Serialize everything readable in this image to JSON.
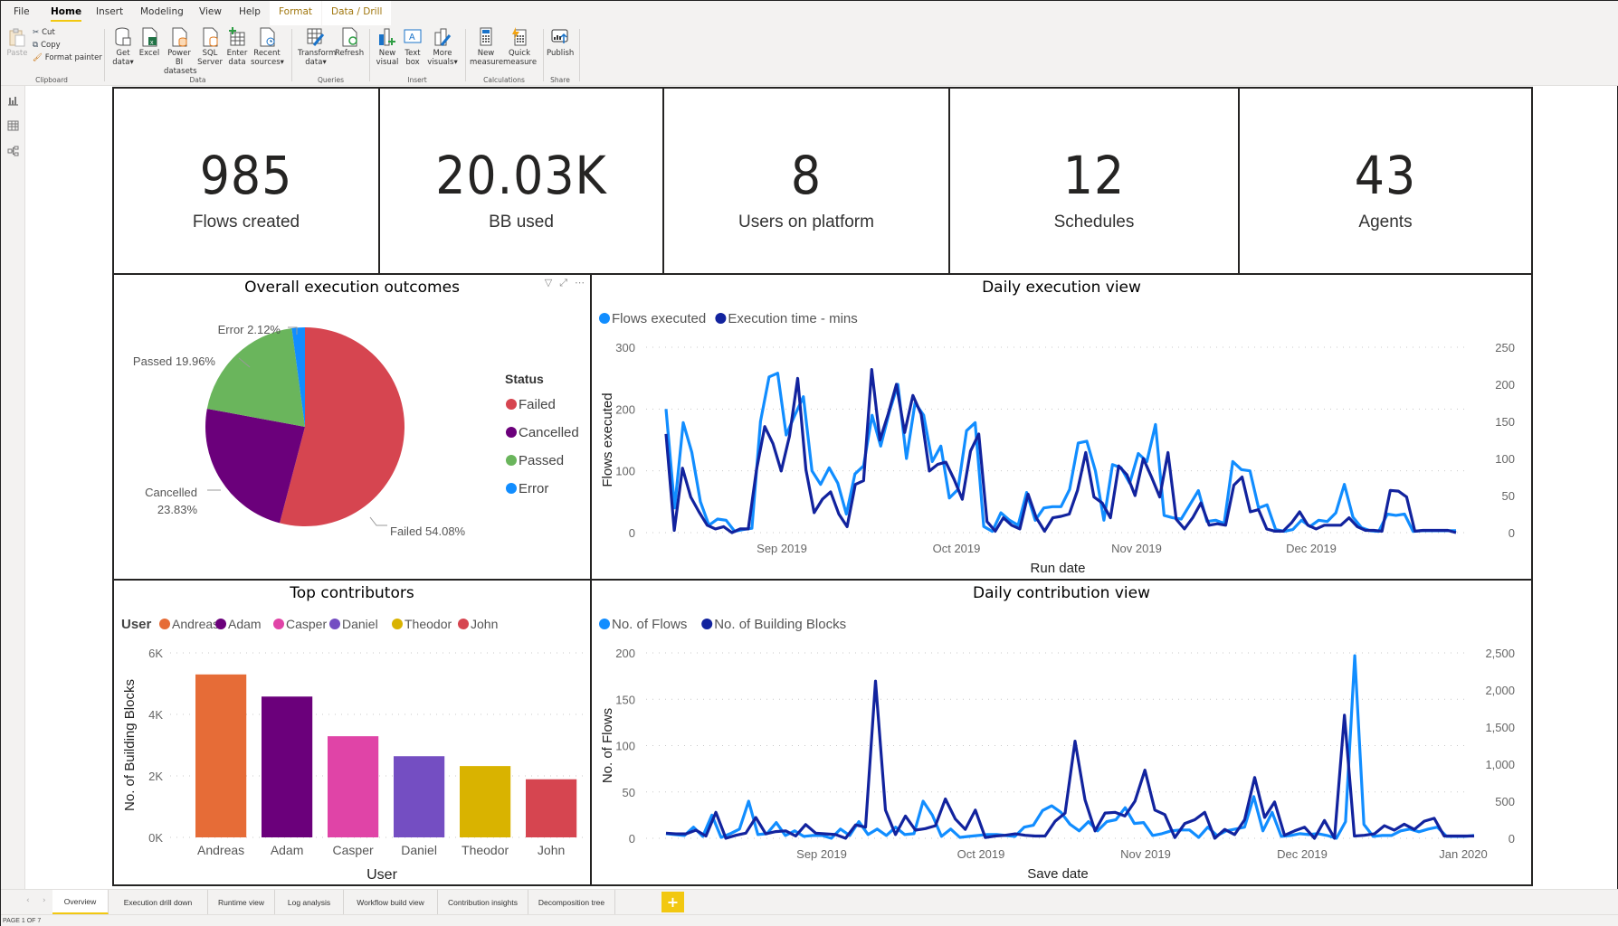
{
  "ribbon": {
    "tabs": [
      {
        "label": "File",
        "active": false,
        "contextual": false
      },
      {
        "label": "Home",
        "active": true,
        "contextual": false
      },
      {
        "label": "Insert",
        "active": false,
        "contextual": false
      },
      {
        "label": "Modeling",
        "active": false,
        "contextual": false
      },
      {
        "label": "View",
        "active": false,
        "contextual": false
      },
      {
        "label": "Help",
        "active": false,
        "contextual": false
      },
      {
        "label": "Format",
        "active": false,
        "contextual": true
      },
      {
        "label": "Data / Drill",
        "active": false,
        "contextual": true
      }
    ],
    "clipboard": {
      "paste": "Paste",
      "cut": "Cut",
      "copy": "Copy",
      "format_painter": "Format painter",
      "group": "Clipboard"
    },
    "data": {
      "get_data": [
        "Get",
        "data"
      ],
      "excel": "Excel",
      "powerbi": [
        "Power BI",
        "datasets"
      ],
      "sql": [
        "SQL",
        "Server"
      ],
      "enter": [
        "Enter",
        "data"
      ],
      "recent": [
        "Recent",
        "sources"
      ],
      "group": "Data"
    },
    "queries": {
      "transform": [
        "Transform",
        "data"
      ],
      "refresh": "Refresh",
      "group": "Queries"
    },
    "insert": {
      "new_visual": [
        "New",
        "visual"
      ],
      "text_box": [
        "Text",
        "box"
      ],
      "more_visuals": [
        "More",
        "visuals"
      ],
      "group": "Insert"
    },
    "calculations": {
      "new_measure": [
        "New",
        "measure"
      ],
      "quick_measure": [
        "Quick",
        "measure"
      ],
      "group": "Calculations"
    },
    "share": {
      "publish": "Publish",
      "group": "Share"
    }
  },
  "kpis": [
    {
      "value": "985",
      "label": "Flows created"
    },
    {
      "value": "20.03K",
      "label": "BB used"
    },
    {
      "value": "8",
      "label": "Users on platform"
    },
    {
      "value": "12",
      "label": "Schedules"
    },
    {
      "value": "43",
      "label": "Agents"
    }
  ],
  "colors": {
    "failed": "#d64550",
    "cancelled": "#6b007b",
    "passed": "#6ab55c",
    "error": "#118dff",
    "light_line": "#118dff",
    "dark_line": "#12239e",
    "andreas": "#e66c37",
    "adam": "#6b007b",
    "casper": "#e044a7",
    "daniel": "#744ec2",
    "theodor": "#d9b300",
    "john": "#d64550",
    "accent": "#f2c811"
  },
  "pages": {
    "tabs": [
      "Overview",
      "Execution drill down",
      "Runtime view",
      "Log analysis",
      "Workflow build view",
      "Contribution insights",
      "Decomposition tree"
    ],
    "active": 0,
    "add": "+",
    "status": "PAGE 1 OF 7"
  },
  "chart_data": [
    {
      "type": "pie",
      "title": "Overall execution outcomes",
      "legend_title": "Status",
      "legend_position": "right",
      "slices": [
        {
          "label": "Failed",
          "value": 54.08,
          "display": "Failed 54.08%"
        },
        {
          "label": "Cancelled",
          "value": 23.83,
          "display": "Cancelled 23.83%"
        },
        {
          "label": "Passed",
          "value": 19.96,
          "display": "Passed 19.96%"
        },
        {
          "label": "Error",
          "value": 2.12,
          "display": "Error 2.12%"
        }
      ]
    },
    {
      "type": "line",
      "title": "Daily execution view",
      "xlabel": "Run date",
      "ylabel": "Flows executed",
      "legend_position": "top-left",
      "x_ticks": [
        "Sep 2019",
        "Oct 2019",
        "Nov 2019",
        "Dec 2019"
      ],
      "y_ticks": [
        0,
        100,
        200,
        300
      ],
      "y2_ticks": [
        0,
        50,
        100,
        150,
        200,
        250
      ],
      "ylim": [
        0,
        300
      ],
      "y2lim": [
        0,
        250
      ],
      "grid": true,
      "series": [
        {
          "name": "Flows executed",
          "axis": "left",
          "values": [
            200,
            40,
            178,
            130,
            50,
            12,
            22,
            20,
            2,
            5,
            7,
            180,
            252,
            258,
            158,
            190,
            220,
            100,
            78,
            105,
            80,
            30,
            95,
            108,
            190,
            140,
            195,
            240,
            120,
            210,
            190,
            115,
            140,
            56,
            70,
            165,
            178,
            10,
            2,
            32,
            20,
            12,
            65,
            20,
            40,
            42,
            42,
            70,
            145,
            148,
            100,
            20,
            110,
            105,
            80,
            128,
            115,
            175,
            28,
            24,
            22,
            45,
            68,
            18,
            20,
            15,
            115,
            102,
            100,
            40,
            45,
            5,
            2,
            5,
            20,
            10,
            20,
            18,
            32,
            78,
            25,
            8,
            3,
            2,
            30,
            28,
            30,
            2,
            3,
            3,
            3,
            3,
            3
          ]
        },
        {
          "name": "Execution time - mins",
          "axis": "right",
          "values": [
            133,
            3,
            87,
            48,
            28,
            10,
            5,
            8,
            0,
            5,
            5,
            85,
            143,
            120,
            83,
            130,
            208,
            85,
            27,
            45,
            55,
            25,
            8,
            65,
            70,
            220,
            125,
            160,
            200,
            135,
            185,
            160,
            83,
            92,
            95,
            72,
            45,
            110,
            133,
            15,
            2,
            20,
            10,
            5,
            52,
            20,
            2,
            20,
            22,
            25,
            57,
            108,
            48,
            40,
            20,
            90,
            78,
            50,
            100,
            75,
            48,
            108,
            18,
            5,
            20,
            40,
            10,
            12,
            10,
            64,
            75,
            28,
            31,
            5,
            2,
            2,
            13,
            28,
            10,
            5,
            10,
            10,
            10,
            20,
            8,
            3,
            3,
            2,
            57,
            56,
            48,
            2,
            3,
            3,
            3,
            3,
            0
          ]
        }
      ]
    },
    {
      "type": "bar",
      "title": "Top contributors",
      "legend_title": "User",
      "legend_position": "top-left",
      "xlabel": "User",
      "ylabel": "No. of Building Blocks",
      "categories": [
        "Andreas",
        "Adam",
        "Casper",
        "Daniel",
        "Theodor",
        "John"
      ],
      "values": [
        5300,
        4580,
        3290,
        2640,
        2320,
        1890
      ],
      "y_ticks": [
        "0K",
        "2K",
        "4K",
        "6K"
      ],
      "ylim": [
        0,
        6000
      ],
      "grid": true
    },
    {
      "type": "line",
      "title": "Daily contribution view",
      "xlabel": "Save date",
      "ylabel": "No. of Flows",
      "legend_position": "top-left",
      "x_ticks": [
        "Sep 2019",
        "Oct 2019",
        "Nov 2019",
        "Dec 2019",
        "Jan 2020"
      ],
      "y_ticks": [
        0,
        50,
        100,
        150,
        200
      ],
      "y2_ticks": [
        "0",
        "500",
        "1,000",
        "1,500",
        "2,000",
        "2,500"
      ],
      "ylim": [
        0,
        200
      ],
      "y2lim": [
        0,
        2500
      ],
      "grid": true,
      "series": [
        {
          "name": "No. of Flows",
          "axis": "left",
          "values": [
            5,
            4,
            3,
            12,
            2,
            25,
            1,
            5,
            10,
            40,
            4,
            5,
            17,
            3,
            8,
            2,
            3,
            3,
            0,
            10,
            3,
            18,
            4,
            10,
            3,
            12,
            4,
            5,
            40,
            25,
            2,
            10,
            1,
            2,
            3,
            4,
            4,
            3,
            2,
            12,
            14,
            30,
            35,
            28,
            15,
            8,
            18,
            8,
            18,
            20,
            33,
            16,
            17,
            3,
            5,
            8,
            9,
            9,
            1,
            12,
            3,
            8,
            10,
            12,
            45,
            8,
            28,
            2,
            3,
            5,
            4,
            5,
            3,
            0,
            18,
            197,
            15,
            2,
            3,
            3,
            8,
            10,
            7,
            10,
            12,
            2,
            2,
            2,
            3
          ]
        },
        {
          "name": "No. of Building Blocks",
          "axis": "right",
          "values": [
            70,
            60,
            60,
            110,
            30,
            350,
            0,
            40,
            70,
            280,
            60,
            90,
            100,
            30,
            185,
            70,
            60,
            50,
            0,
            180,
            150,
            2120,
            380,
            50,
            300,
            110,
            130,
            170,
            530,
            260,
            120,
            380,
            10,
            30,
            40,
            60,
            40,
            30,
            30,
            230,
            340,
            1310,
            520,
            100,
            340,
            350,
            300,
            500,
            920,
            380,
            320,
            10,
            200,
            250,
            350,
            0,
            120,
            50,
            250,
            820,
            280,
            490,
            40,
            100,
            150,
            0,
            240,
            0,
            1660,
            30,
            40,
            60,
            170,
            110,
            190,
            120,
            230,
            270,
            30,
            30,
            30,
            30
          ]
        }
      ]
    }
  ]
}
